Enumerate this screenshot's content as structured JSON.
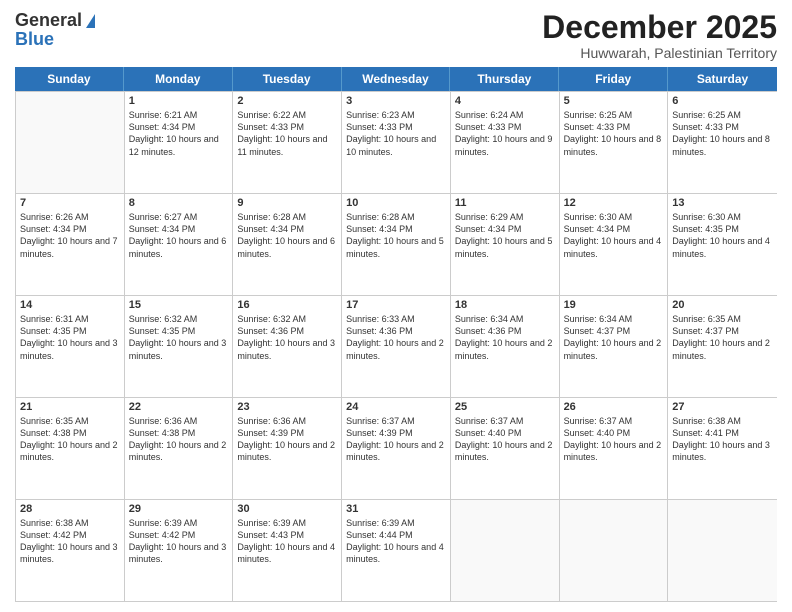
{
  "header": {
    "logo_general": "General",
    "logo_blue": "Blue",
    "month_title": "December 2025",
    "location": "Huwwarah, Palestinian Territory"
  },
  "weekdays": [
    "Sunday",
    "Monday",
    "Tuesday",
    "Wednesday",
    "Thursday",
    "Friday",
    "Saturday"
  ],
  "rows": [
    [
      {
        "num": "",
        "sunrise": "",
        "sunset": "",
        "daylight": "",
        "empty": true
      },
      {
        "num": "1",
        "sunrise": "Sunrise: 6:21 AM",
        "sunset": "Sunset: 4:34 PM",
        "daylight": "Daylight: 10 hours and 12 minutes."
      },
      {
        "num": "2",
        "sunrise": "Sunrise: 6:22 AM",
        "sunset": "Sunset: 4:33 PM",
        "daylight": "Daylight: 10 hours and 11 minutes."
      },
      {
        "num": "3",
        "sunrise": "Sunrise: 6:23 AM",
        "sunset": "Sunset: 4:33 PM",
        "daylight": "Daylight: 10 hours and 10 minutes."
      },
      {
        "num": "4",
        "sunrise": "Sunrise: 6:24 AM",
        "sunset": "Sunset: 4:33 PM",
        "daylight": "Daylight: 10 hours and 9 minutes."
      },
      {
        "num": "5",
        "sunrise": "Sunrise: 6:25 AM",
        "sunset": "Sunset: 4:33 PM",
        "daylight": "Daylight: 10 hours and 8 minutes."
      },
      {
        "num": "6",
        "sunrise": "Sunrise: 6:25 AM",
        "sunset": "Sunset: 4:33 PM",
        "daylight": "Daylight: 10 hours and 8 minutes."
      }
    ],
    [
      {
        "num": "7",
        "sunrise": "Sunrise: 6:26 AM",
        "sunset": "Sunset: 4:34 PM",
        "daylight": "Daylight: 10 hours and 7 minutes."
      },
      {
        "num": "8",
        "sunrise": "Sunrise: 6:27 AM",
        "sunset": "Sunset: 4:34 PM",
        "daylight": "Daylight: 10 hours and 6 minutes."
      },
      {
        "num": "9",
        "sunrise": "Sunrise: 6:28 AM",
        "sunset": "Sunset: 4:34 PM",
        "daylight": "Daylight: 10 hours and 6 minutes."
      },
      {
        "num": "10",
        "sunrise": "Sunrise: 6:28 AM",
        "sunset": "Sunset: 4:34 PM",
        "daylight": "Daylight: 10 hours and 5 minutes."
      },
      {
        "num": "11",
        "sunrise": "Sunrise: 6:29 AM",
        "sunset": "Sunset: 4:34 PM",
        "daylight": "Daylight: 10 hours and 5 minutes."
      },
      {
        "num": "12",
        "sunrise": "Sunrise: 6:30 AM",
        "sunset": "Sunset: 4:34 PM",
        "daylight": "Daylight: 10 hours and 4 minutes."
      },
      {
        "num": "13",
        "sunrise": "Sunrise: 6:30 AM",
        "sunset": "Sunset: 4:35 PM",
        "daylight": "Daylight: 10 hours and 4 minutes."
      }
    ],
    [
      {
        "num": "14",
        "sunrise": "Sunrise: 6:31 AM",
        "sunset": "Sunset: 4:35 PM",
        "daylight": "Daylight: 10 hours and 3 minutes."
      },
      {
        "num": "15",
        "sunrise": "Sunrise: 6:32 AM",
        "sunset": "Sunset: 4:35 PM",
        "daylight": "Daylight: 10 hours and 3 minutes."
      },
      {
        "num": "16",
        "sunrise": "Sunrise: 6:32 AM",
        "sunset": "Sunset: 4:36 PM",
        "daylight": "Daylight: 10 hours and 3 minutes."
      },
      {
        "num": "17",
        "sunrise": "Sunrise: 6:33 AM",
        "sunset": "Sunset: 4:36 PM",
        "daylight": "Daylight: 10 hours and 2 minutes."
      },
      {
        "num": "18",
        "sunrise": "Sunrise: 6:34 AM",
        "sunset": "Sunset: 4:36 PM",
        "daylight": "Daylight: 10 hours and 2 minutes."
      },
      {
        "num": "19",
        "sunrise": "Sunrise: 6:34 AM",
        "sunset": "Sunset: 4:37 PM",
        "daylight": "Daylight: 10 hours and 2 minutes."
      },
      {
        "num": "20",
        "sunrise": "Sunrise: 6:35 AM",
        "sunset": "Sunset: 4:37 PM",
        "daylight": "Daylight: 10 hours and 2 minutes."
      }
    ],
    [
      {
        "num": "21",
        "sunrise": "Sunrise: 6:35 AM",
        "sunset": "Sunset: 4:38 PM",
        "daylight": "Daylight: 10 hours and 2 minutes."
      },
      {
        "num": "22",
        "sunrise": "Sunrise: 6:36 AM",
        "sunset": "Sunset: 4:38 PM",
        "daylight": "Daylight: 10 hours and 2 minutes."
      },
      {
        "num": "23",
        "sunrise": "Sunrise: 6:36 AM",
        "sunset": "Sunset: 4:39 PM",
        "daylight": "Daylight: 10 hours and 2 minutes."
      },
      {
        "num": "24",
        "sunrise": "Sunrise: 6:37 AM",
        "sunset": "Sunset: 4:39 PM",
        "daylight": "Daylight: 10 hours and 2 minutes."
      },
      {
        "num": "25",
        "sunrise": "Sunrise: 6:37 AM",
        "sunset": "Sunset: 4:40 PM",
        "daylight": "Daylight: 10 hours and 2 minutes."
      },
      {
        "num": "26",
        "sunrise": "Sunrise: 6:37 AM",
        "sunset": "Sunset: 4:40 PM",
        "daylight": "Daylight: 10 hours and 2 minutes."
      },
      {
        "num": "27",
        "sunrise": "Sunrise: 6:38 AM",
        "sunset": "Sunset: 4:41 PM",
        "daylight": "Daylight: 10 hours and 3 minutes."
      }
    ],
    [
      {
        "num": "28",
        "sunrise": "Sunrise: 6:38 AM",
        "sunset": "Sunset: 4:42 PM",
        "daylight": "Daylight: 10 hours and 3 minutes."
      },
      {
        "num": "29",
        "sunrise": "Sunrise: 6:39 AM",
        "sunset": "Sunset: 4:42 PM",
        "daylight": "Daylight: 10 hours and 3 minutes."
      },
      {
        "num": "30",
        "sunrise": "Sunrise: 6:39 AM",
        "sunset": "Sunset: 4:43 PM",
        "daylight": "Daylight: 10 hours and 4 minutes."
      },
      {
        "num": "31",
        "sunrise": "Sunrise: 6:39 AM",
        "sunset": "Sunset: 4:44 PM",
        "daylight": "Daylight: 10 hours and 4 minutes."
      },
      {
        "num": "",
        "sunrise": "",
        "sunset": "",
        "daylight": "",
        "empty": true
      },
      {
        "num": "",
        "sunrise": "",
        "sunset": "",
        "daylight": "",
        "empty": true
      },
      {
        "num": "",
        "sunrise": "",
        "sunset": "",
        "daylight": "",
        "empty": true
      }
    ]
  ]
}
